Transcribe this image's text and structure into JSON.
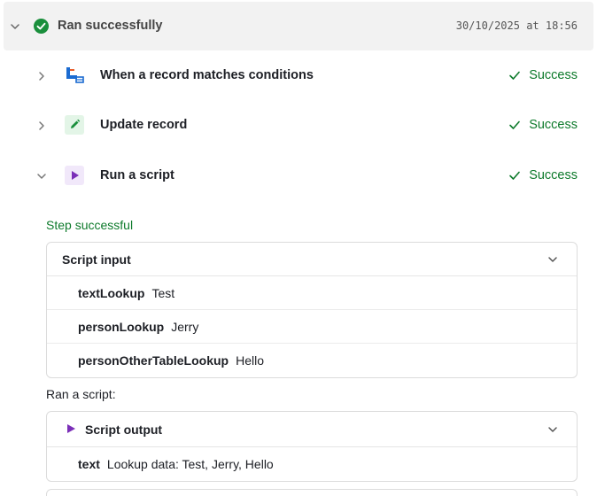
{
  "run": {
    "status_label": "Ran successfully",
    "timestamp": "30/10/2025 at 18:56",
    "status_color": "#1a8f3c"
  },
  "steps": [
    {
      "label": "When a record matches conditions",
      "status": "Success",
      "icon": "trigger-condition-icon"
    },
    {
      "label": "Update record",
      "status": "Success",
      "icon": "pencil-icon"
    },
    {
      "label": "Run a script",
      "status": "Success",
      "icon": "play-icon"
    }
  ],
  "details": {
    "step_result": "Step successful",
    "script_input": {
      "title": "Script input",
      "rows": [
        {
          "key": "textLookup",
          "value": "Test"
        },
        {
          "key": "personLookup",
          "value": "Jerry"
        },
        {
          "key": "personOtherTableLookup",
          "value": "Hello"
        }
      ]
    },
    "ran_label": "Ran a script:",
    "script_output": {
      "title": "Script output",
      "rows": [
        {
          "key": "text",
          "value": "Lookup data: Test, Jerry, Hello"
        }
      ]
    }
  },
  "colors": {
    "success_text": "#0d7a2b",
    "script_accent": "#7b2fb8",
    "update_accent": "#1a8f3c",
    "trigger_accent": "#1b6bd1"
  }
}
